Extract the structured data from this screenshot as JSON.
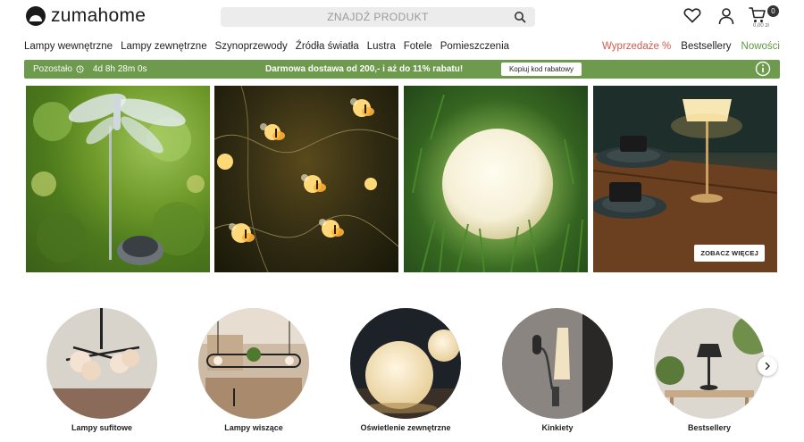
{
  "brand": {
    "name": "zumahome"
  },
  "search": {
    "placeholder": "ZNAJDŹ PRODUKT"
  },
  "cart": {
    "count": "0",
    "total": "0,00 zł"
  },
  "nav": {
    "left": [
      "Lampy wewnętrzne",
      "Lampy zewnętrzne",
      "Szynoprzewody",
      "Źródła światła",
      "Lustra",
      "Fotele",
      "Pomieszczenia"
    ],
    "right": {
      "sale": "Wyprzedaże %",
      "bestsellers": "Bestsellery",
      "new": "Nowości"
    }
  },
  "colors": {
    "promo_bg": "#6e9a4e",
    "sale": "#d6584a",
    "new": "#5a9a3e"
  },
  "promo": {
    "timer_label": "Pozostało",
    "timer_value": "4d 8h 28m 0s",
    "text": "Darmowa dostawa od 200,- i aż do 11% rabatu!",
    "copy_button": "Kopiuj kod rabatowy"
  },
  "hero": {
    "see_more": "ZOBACZ WIĘCEJ"
  },
  "categories": [
    {
      "label": "Lampy sufitowe"
    },
    {
      "label": "Lampy wiszące"
    },
    {
      "label": "Oświetlenie zewnętrzne"
    },
    {
      "label": "Kinkiety"
    },
    {
      "label": "Bestsellery"
    }
  ]
}
